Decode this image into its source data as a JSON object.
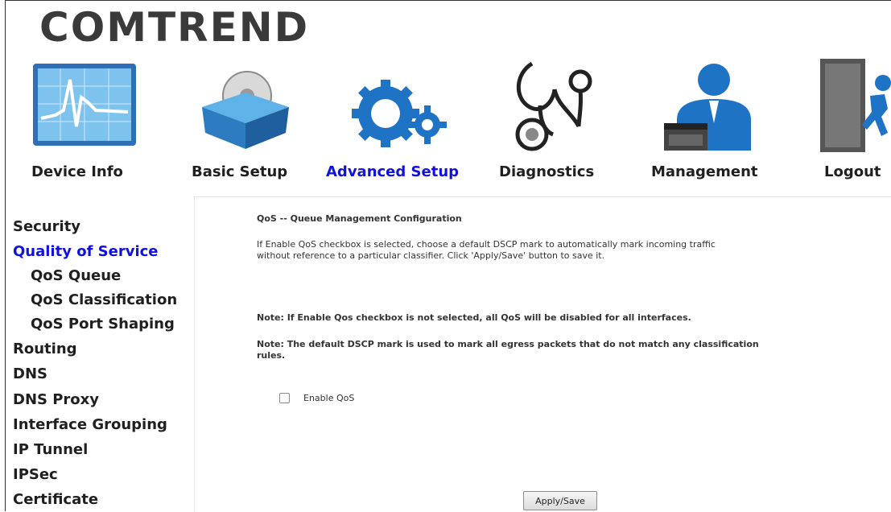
{
  "brand": {
    "logo_text": "COMTREND"
  },
  "nav": {
    "items": [
      {
        "label": "Device Info",
        "icon": "device-info-icon"
      },
      {
        "label": "Basic Setup",
        "icon": "basic-setup-icon"
      },
      {
        "label": "Advanced Setup",
        "icon": "advanced-setup-icon",
        "active": true
      },
      {
        "label": "Diagnostics",
        "icon": "diagnostics-icon"
      },
      {
        "label": "Management",
        "icon": "management-icon"
      },
      {
        "label": "Logout",
        "icon": "logout-icon"
      }
    ]
  },
  "sidebar": {
    "items": [
      {
        "label": "Security"
      },
      {
        "label": "Quality of Service",
        "active": true
      },
      {
        "label": "QoS Queue",
        "sub": true
      },
      {
        "label": "QoS Classification",
        "sub": true
      },
      {
        "label": "QoS Port Shaping",
        "sub": true
      },
      {
        "label": "Routing"
      },
      {
        "label": "DNS"
      },
      {
        "label": "DNS Proxy"
      },
      {
        "label": "Interface Grouping"
      },
      {
        "label": "IP Tunnel"
      },
      {
        "label": "IPSec"
      },
      {
        "label": "Certificate"
      }
    ]
  },
  "content": {
    "title": "QoS -- Queue Management Configuration",
    "description_line1": "If Enable QoS checkbox is selected, choose a default DSCP mark to automatically mark incoming traffic",
    "description_line2": "without reference to a particular classifier. Click 'Apply/Save' button to save it.",
    "note1": "Note: If Enable Qos checkbox is not selected, all QoS will be disabled for all interfaces.",
    "note2": "Note: The default DSCP mark is used to mark all egress packets that do not match any classification rules.",
    "enable_qos_label": "Enable QoS",
    "enable_qos_checked": false,
    "apply_button": "Apply/Save"
  },
  "colors": {
    "active_link": "#1111dd",
    "text": "#1f1f1f",
    "icon_blue": "#2a7fc9"
  }
}
